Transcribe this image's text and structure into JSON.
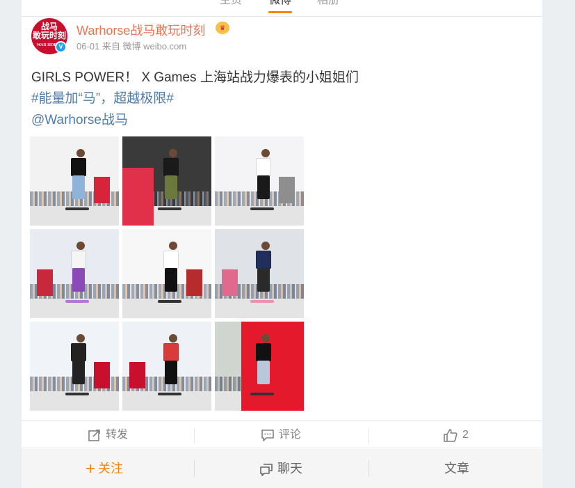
{
  "tabs": [
    {
      "label": "主页"
    },
    {
      "label": "微博"
    },
    {
      "label": "相册"
    }
  ],
  "post": {
    "username": "Warhorse战马敢玩时刻",
    "avatar_text_top": "战马",
    "avatar_text_mid": "敢玩时刻",
    "avatar_text_sub": "WAR HORSE",
    "verified_icon": "V",
    "vip_icon": "vip-crown-icon",
    "meta": "06-01 来自 微博 weibo.com",
    "text": "GIRLS POWER！ X Games 上海站战力爆表的小姐姐们",
    "hashtag": "#能量加“马”，超越极限#",
    "mention": "@Warhorse战马"
  },
  "photos": [
    {
      "name": "photo-1",
      "sky": "#f2f2f2",
      "accent": "#d8243a",
      "shirt": "#111111",
      "pants": "#8fb3d9"
    },
    {
      "name": "photo-2",
      "sky": "#3a3a3a",
      "accent": "#e0304a",
      "shirt": "#1a1a1a",
      "pants": "#6b7a3c"
    },
    {
      "name": "photo-3",
      "sky": "#f4f4f6",
      "accent": "#8e8e8e",
      "shirt": "#ffffff",
      "pants": "#1a1a1a"
    },
    {
      "name": "photo-4",
      "sky": "#e8ecf2",
      "accent": "#c7283b",
      "shirt": "#f5f5f5",
      "pants": "#8a4bb8"
    },
    {
      "name": "photo-5",
      "sky": "#f7f7f7",
      "accent": "#b62b2b",
      "shirt": "#ffffff",
      "pants": "#111111"
    },
    {
      "name": "photo-6",
      "sky": "#dfe3e8",
      "accent": "#e06a8e",
      "shirt": "#1f2f5a",
      "pants": "#2a2a2a"
    },
    {
      "name": "photo-7",
      "sky": "#f0f3f7",
      "accent": "#c8102e",
      "shirt": "#222222",
      "pants": "#222222"
    },
    {
      "name": "photo-8",
      "sky": "#eef1f6",
      "accent": "#c8102e",
      "shirt": "#d93a3a",
      "pants": "#111111"
    },
    {
      "name": "photo-9",
      "sky": "#cfd6d0",
      "accent": "#e4192b",
      "shirt": "#111111",
      "pants": "#b8c7dc"
    }
  ],
  "actions": {
    "repost": "转发",
    "comment": "评论",
    "like_count": "2"
  },
  "bottom": {
    "follow": "关注",
    "follow_prefix": "+",
    "chat": "聊天",
    "article": "文章"
  },
  "colors": {
    "accent_orange": "#ff8200",
    "username": "#eb7350",
    "link": "#507daf"
  }
}
